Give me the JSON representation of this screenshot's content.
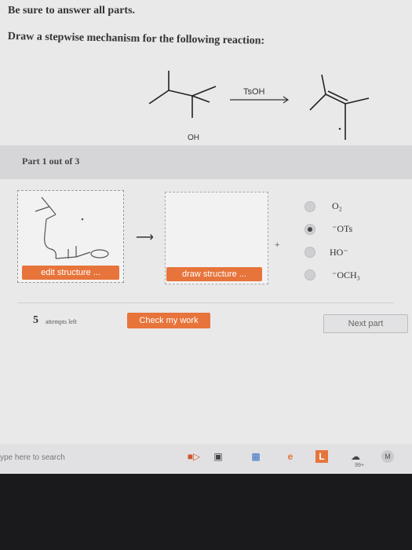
{
  "question": {
    "line1": "Be sure to answer all parts.",
    "line2": "Draw a stepwise mechanism for the following reaction:"
  },
  "reaction": {
    "reagent": "TsOH",
    "oh_label": "OH"
  },
  "part": {
    "label": "Part 1 out of 3"
  },
  "structure_boxes": {
    "edit_label": "edit structure ...",
    "draw_label": "draw structure ...",
    "arrow": "⟶",
    "plus": "+"
  },
  "options": [
    {
      "label": "O₂",
      "selected": false
    },
    {
      "label": "⁻OTs",
      "selected": true
    },
    {
      "label": "HO⁻",
      "selected": false
    },
    {
      "label": "⁻OCH₃",
      "selected": false
    }
  ],
  "footer": {
    "attempts_count": "5",
    "attempts_text": "attempts left",
    "check_label": "Check my work",
    "next_label": "Next part"
  },
  "taskbar": {
    "search_placeholder": "ype here to search",
    "icons": [
      "speaker-icon",
      "task-view-icon",
      "store-icon",
      "edge-icon",
      "app-l-icon",
      "cloud-icon",
      "mcgraw-icon"
    ],
    "badge": "99+"
  },
  "colors": {
    "accent": "#e7743b",
    "background": "#e9e9ea"
  }
}
